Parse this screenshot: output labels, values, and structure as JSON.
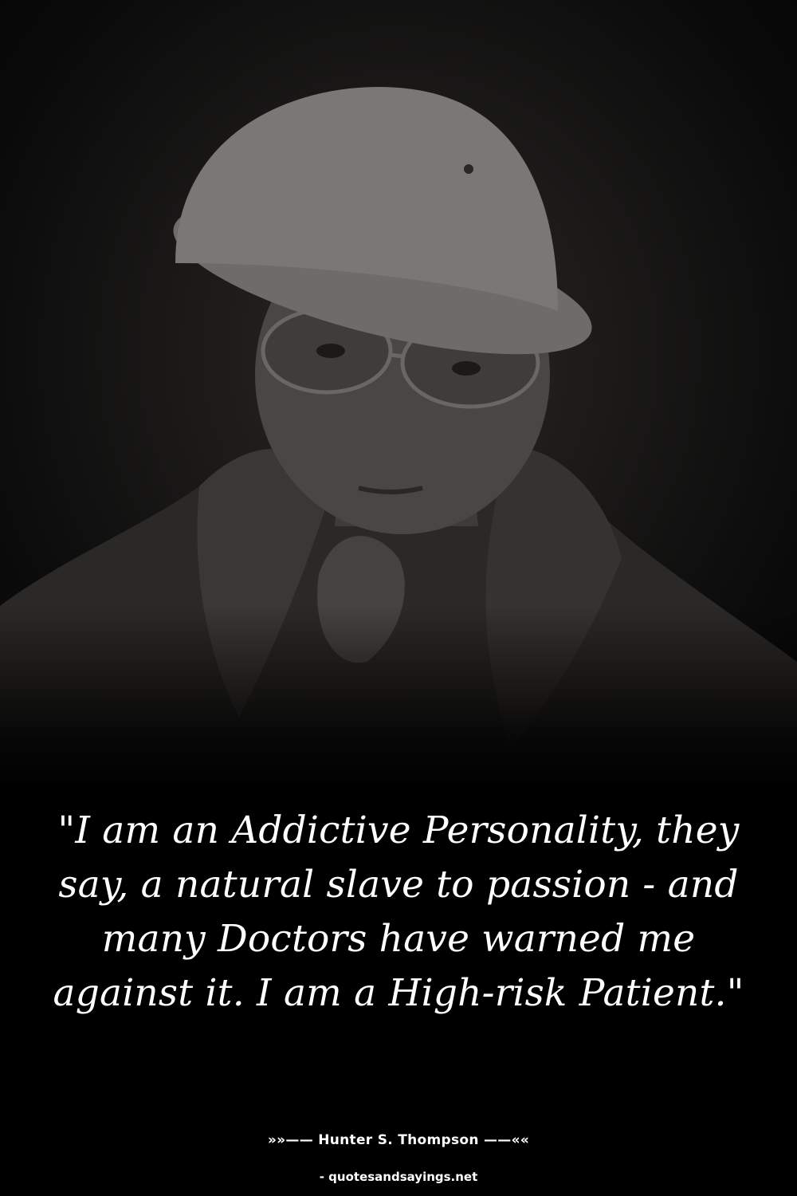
{
  "quote": {
    "text": "\"I am an Addictive Personality, they say, a natural slave to passion - and many Doctors have warned me against it. I am a High-risk Patient.\""
  },
  "author": {
    "line": "»»—— Hunter S. Thompson ——««"
  },
  "source": {
    "line": "- quotesandsayings.net"
  },
  "colors": {
    "background": "#000000",
    "text": "#ffffff"
  }
}
